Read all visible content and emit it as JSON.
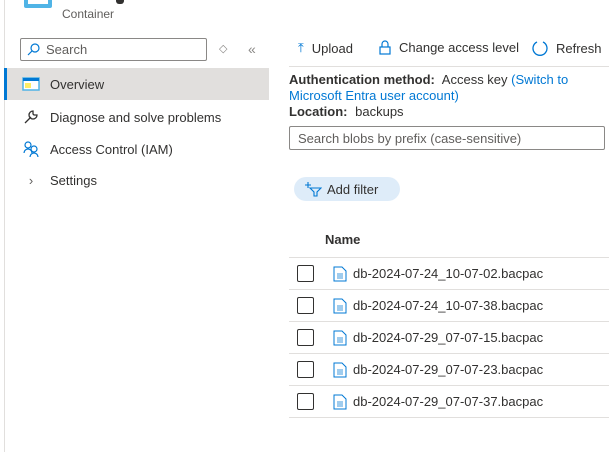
{
  "header": {
    "subtitle": "Container"
  },
  "sidebar": {
    "search_placeholder": "Search",
    "items": [
      {
        "label": "Overview"
      },
      {
        "label": "Diagnose and solve problems"
      },
      {
        "label": "Access Control (IAM)"
      },
      {
        "label": "Settings"
      }
    ]
  },
  "toolbar": {
    "upload": "Upload",
    "change_access": "Change access level",
    "refresh": "Refresh"
  },
  "info": {
    "auth_label": "Authentication method:",
    "auth_value": "Access key",
    "auth_link": "(Switch to Microsoft Entra user account)",
    "location_label": "Location:",
    "location_value": "backups"
  },
  "blob_search": {
    "placeholder": "Search blobs by prefix (case-sensitive)"
  },
  "filter": {
    "label": "Add filter"
  },
  "table": {
    "name_header": "Name",
    "rows": [
      "db-2024-07-24_10-07-02.bacpac",
      "db-2024-07-24_10-07-38.bacpac",
      "db-2024-07-29_07-07-15.bacpac",
      "db-2024-07-29_07-07-23.bacpac",
      "db-2024-07-29_07-07-37.bacpac"
    ]
  }
}
